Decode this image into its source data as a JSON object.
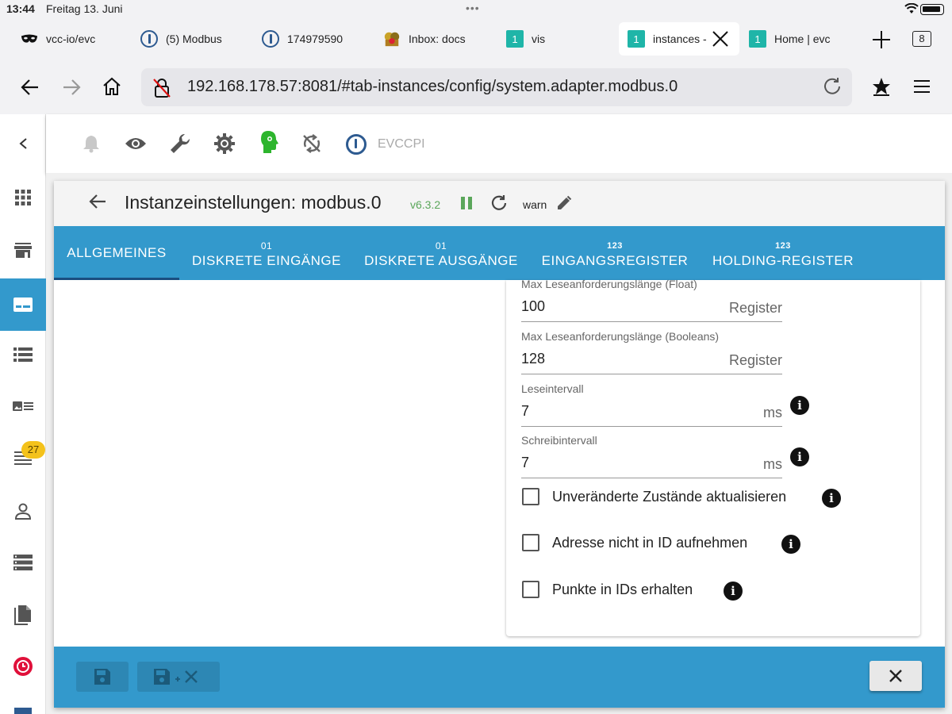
{
  "statusbar": {
    "time": "13:44",
    "date": "Freitag 13. Juni",
    "dots": "•••"
  },
  "browser_tabs": [
    {
      "label": "vcc-io/evc",
      "icon": "mask-icon"
    },
    {
      "label": "(5) Modbus",
      "icon": "iobroker-icon"
    },
    {
      "label": "174979590",
      "icon": "iobroker-icon"
    },
    {
      "label": "Inbox: docs",
      "icon": "mail-icon"
    },
    {
      "label": "vis",
      "icon": "number-one-icon",
      "badge": "1"
    },
    {
      "label": "instances -",
      "icon": "number-one-icon",
      "badge": "1",
      "active": true
    },
    {
      "label": "Home | evc",
      "icon": "number-one-icon",
      "badge": "1"
    }
  ],
  "tab_count": "8",
  "address_bar": {
    "url": "192.168.178.57:8081/#tab-instances/config/system.adapter.modbus.0"
  },
  "sidebar": {
    "log_badge": "27"
  },
  "toolbar": {
    "host_name": "EVCCPI"
  },
  "dialog": {
    "title": "Instanzeinstellungen: modbus.0",
    "version": "v6.3.2",
    "log_level": "warn",
    "tabs": [
      {
        "sub": "",
        "label": "ALLGEMEINES",
        "active": true
      },
      {
        "sub": "01",
        "label": "DISKRETE EINGÄNGE"
      },
      {
        "sub": "01",
        "label": "DISKRETE AUSGÄNGE"
      },
      {
        "sub": "123",
        "label": "EINGANGSREGISTER"
      },
      {
        "sub": "123",
        "label": "HOLDING-REGISTER"
      }
    ],
    "fields": [
      {
        "label": "Max Leseanforderungslänge (Float)",
        "value": "100",
        "unit": "Register"
      },
      {
        "label": "Max Leseanforderungslänge (Booleans)",
        "value": "128",
        "unit": "Register"
      },
      {
        "label": "Leseintervall",
        "value": "7",
        "unit": "ms"
      },
      {
        "label": "Schreibintervall",
        "value": "7",
        "unit": "ms"
      }
    ],
    "checkboxes": [
      {
        "label": "Unveränderte Zustände aktualisieren",
        "checked": false
      },
      {
        "label": "Adresse nicht in ID aufnehmen",
        "checked": false
      },
      {
        "label": "Punkte in IDs erhalten",
        "checked": false
      }
    ]
  },
  "colors": {
    "accent": "#3399cc",
    "version_green": "#5aa65a",
    "badge_yellow": "#f4c21b"
  }
}
